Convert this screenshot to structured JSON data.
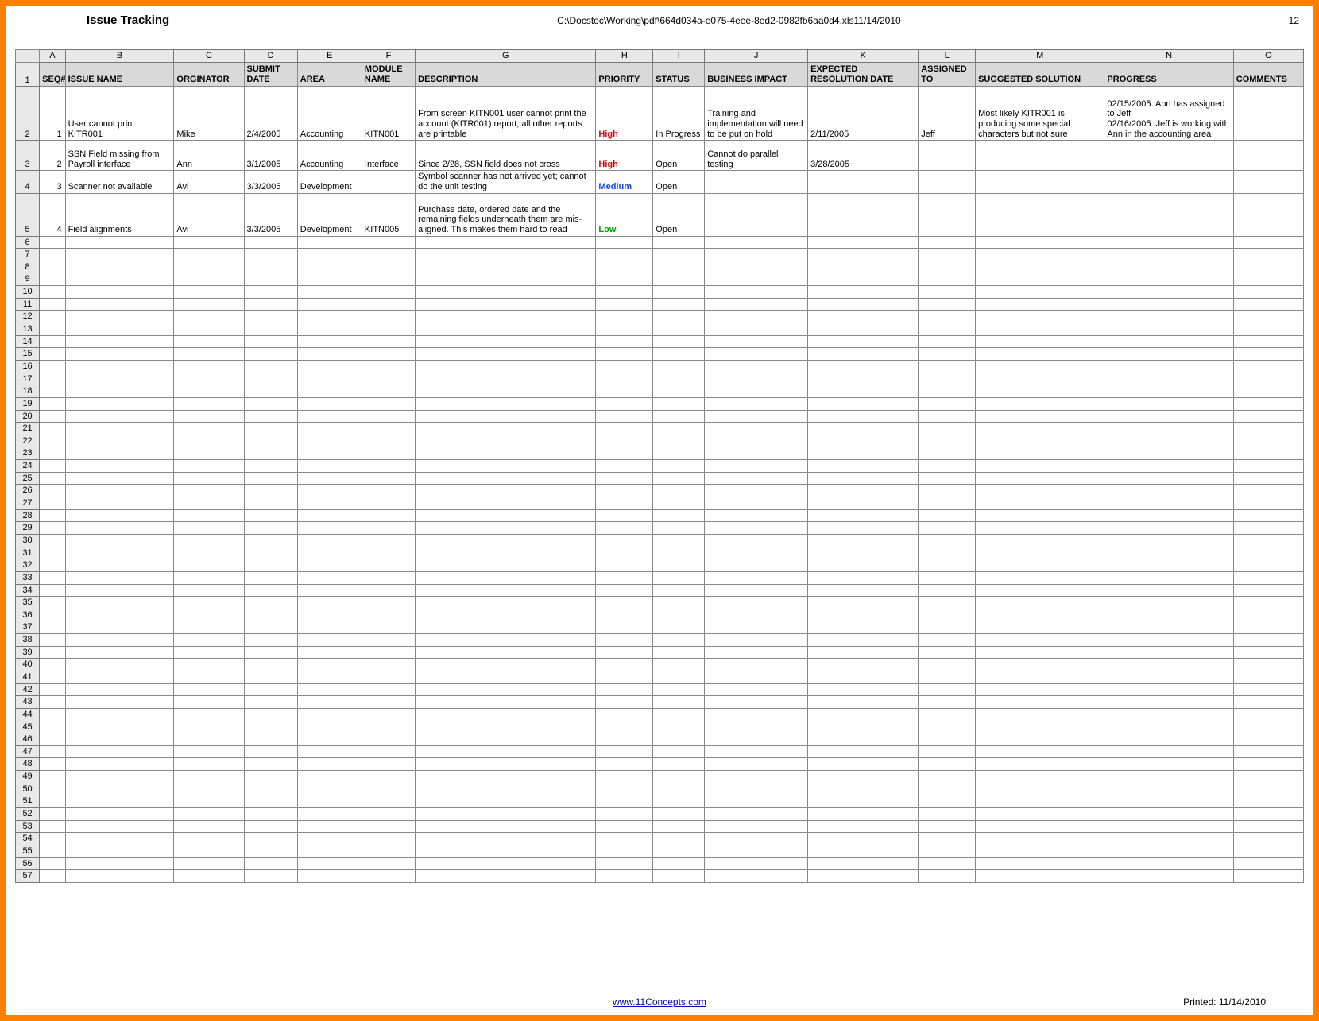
{
  "header": {
    "title": "Issue Tracking",
    "path": "C:\\Docstoc\\Working\\pdf\\664d034a-e075-4eee-8ed2-0982fb6aa0d4.xls11/14/2010",
    "page_number": "12"
  },
  "columns_letters": [
    "A",
    "B",
    "C",
    "D",
    "E",
    "F",
    "G",
    "H",
    "I",
    "J",
    "K",
    "L",
    "M",
    "N",
    "O"
  ],
  "field_headers": {
    "seq": "SEQ#",
    "issue_name": "ISSUE NAME",
    "orginator": "ORGINATOR",
    "submit_date": "SUBMIT DATE",
    "area": "AREA",
    "module_name": "MODULE NAME",
    "description": "DESCRIPTION",
    "priority": "PRIORITY",
    "status": "STATUS",
    "business_impact": "BUSINESS IMPACT",
    "expected_resolution_date": "EXPECTED RESOLUTION DATE",
    "assigned_to": "ASSIGNED TO",
    "suggested_solution": "SUGGESTED SOLUTION",
    "progress": "PROGRESS",
    "comments": "COMMENTS"
  },
  "rows": [
    {
      "rownum": "2",
      "seq": "1",
      "issue_name": "User cannot print KITR001",
      "orginator": "Mike",
      "submit_date": "2/4/2005",
      "area": "Accounting",
      "module_name": "KITN001",
      "description": "From screen KITN001 user cannot print the account (KITR001) report; all other reports are printable",
      "priority": "High",
      "status": "In Progress",
      "business_impact": "Training and implementation will need to be put on hold",
      "expected_resolution_date": "2/11/2005",
      "assigned_to": "Jeff",
      "suggested_solution": "Most likely KITR001 is producing some special characters but not sure",
      "progress": "02/15/2005: Ann has assigned to Jeff\n02/16/2005: Jeff is working with Ann in the accounting area",
      "comments": ""
    },
    {
      "rownum": "3",
      "seq": "2",
      "issue_name": "SSN Field missing from Payroll interface",
      "orginator": "Ann",
      "submit_date": "3/1/2005",
      "area": "Accounting",
      "module_name": "Interface",
      "description": "Since 2/28, SSN field does not cross",
      "priority": "High",
      "status": "Open",
      "business_impact": "Cannot do parallel testing",
      "expected_resolution_date": "3/28/2005",
      "assigned_to": "",
      "suggested_solution": "",
      "progress": "",
      "comments": ""
    },
    {
      "rownum": "4",
      "seq": "3",
      "issue_name": "Scanner not available",
      "orginator": "Avi",
      "submit_date": "3/3/2005",
      "area": "Development",
      "module_name": "",
      "description": "Symbol scanner has not arrived yet; cannot do the unit testing",
      "priority": "Medium",
      "status": "Open",
      "business_impact": "",
      "expected_resolution_date": "",
      "assigned_to": "",
      "suggested_solution": "",
      "progress": "",
      "comments": ""
    },
    {
      "rownum": "5",
      "seq": "4",
      "issue_name": "Field alignments",
      "orginator": "Avi",
      "submit_date": "3/3/2005",
      "area": "Development",
      "module_name": "KITN005",
      "description": "Purchase date, ordered date and the remaining fields underneath them are mis-aligned. This makes them hard to read",
      "priority": "Low",
      "status": "Open",
      "business_impact": "",
      "expected_resolution_date": "",
      "assigned_to": "",
      "suggested_solution": "",
      "progress": "",
      "comments": ""
    }
  ],
  "empty_row_start": 6,
  "empty_row_end": 57,
  "footer": {
    "link_text": "www.11Concepts.com",
    "printed": "Printed: 11/14/2010"
  },
  "col_widths": {
    "rownum": 26,
    "A": 28,
    "B": 118,
    "C": 76,
    "D": 58,
    "E": 70,
    "F": 58,
    "G": 196,
    "H": 62,
    "I": 56,
    "J": 112,
    "K": 120,
    "L": 62,
    "M": 140,
    "N": 140,
    "O": 76
  }
}
